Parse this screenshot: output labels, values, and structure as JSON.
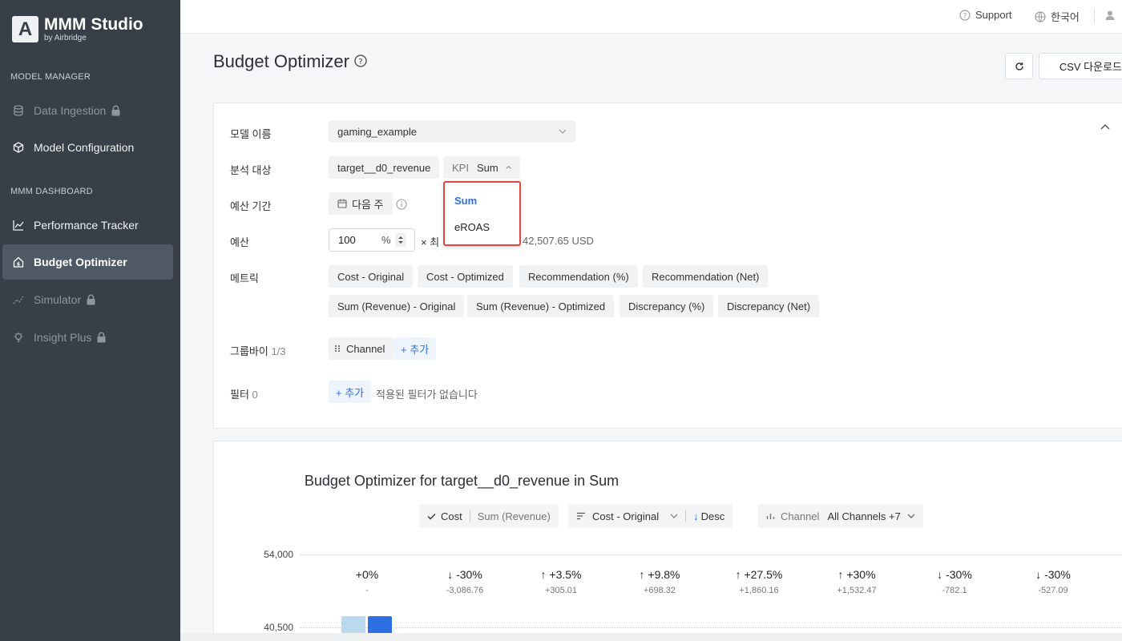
{
  "sidebar": {
    "logo_letter": "A",
    "brand_title": "MMM Studio",
    "brand_sub": "by Airbridge",
    "section_model": "MODEL MANAGER",
    "section_dashboard": "MMM DASHBOARD",
    "items": [
      {
        "label": "Data Ingestion",
        "icon": "database-icon",
        "locked": true
      },
      {
        "label": "Model Configuration",
        "icon": "cube-icon",
        "locked": false
      },
      {
        "label": "Performance Tracker",
        "icon": "line-chart-icon",
        "locked": false
      },
      {
        "label": "Budget Optimizer",
        "icon": "home-dollar-icon",
        "locked": false,
        "active": true
      },
      {
        "label": "Simulator",
        "icon": "trend-icon",
        "locked": true
      },
      {
        "label": "Insight Plus",
        "icon": "bulb-icon",
        "locked": true
      }
    ]
  },
  "topbar": {
    "support": "Support",
    "language": "한국어"
  },
  "page": {
    "title": "Budget Optimizer",
    "csv_button": "CSV 다운로드"
  },
  "form": {
    "model_label": "모델 이름",
    "model_value": "gaming_example",
    "target_label": "분석 대상",
    "target_value": "target__d0_revenue",
    "kpi_prefix": "KPI",
    "kpi_value": "Sum",
    "period_label": "예산 기간",
    "period_value": "다음 주",
    "budget_label": "예산",
    "budget_value": "100",
    "budget_unit": "%",
    "budget_multiplier": "× 최",
    "budget_total": "42,507.65 USD",
    "metric_label": "메트릭",
    "metrics": [
      "Cost - Original",
      "Cost - Optimized",
      "Recommendation (%)",
      "Recommendation (Net)",
      "Sum (Revenue) - Original",
      "Sum (Revenue) - Optimized",
      "Discrepancy (%)",
      "Discrepancy (Net)"
    ],
    "groupby_label": "그룹바이",
    "groupby_count": "1/3",
    "groupby_value": "Channel",
    "add_label": "+ 추가",
    "filter_label": "필터",
    "filter_count": "0",
    "filter_empty": "적용된 필터가 없습니다"
  },
  "kpi_dropdown": {
    "options": [
      "Sum",
      "eROAS"
    ],
    "selected": "Sum"
  },
  "chart_controls": {
    "cost": "Cost",
    "sum_revenue": "Sum (Revenue)",
    "sort_field": "Cost - Original",
    "sort_dir": "Desc",
    "channel_prefix": "Channel",
    "channel_value": "All Channels +7"
  },
  "chart_data": {
    "type": "bar",
    "title": "Budget Optimizer for target__d0_revenue in Sum",
    "y_ticks": [
      "54,000",
      "40,500"
    ],
    "changes": [
      {
        "dir": "none",
        "pct": "+0%",
        "net": "-"
      },
      {
        "dir": "down",
        "pct": "-30%",
        "net": "-3,086.76"
      },
      {
        "dir": "up",
        "pct": "+3.5%",
        "net": "+305.01"
      },
      {
        "dir": "up",
        "pct": "+9.8%",
        "net": "+698.32"
      },
      {
        "dir": "up",
        "pct": "+27.5%",
        "net": "+1,860.16"
      },
      {
        "dir": "up",
        "pct": "+30%",
        "net": "+1,532.47"
      },
      {
        "dir": "down",
        "pct": "-30%",
        "net": "-782.1"
      },
      {
        "dir": "down",
        "pct": "-30%",
        "net": "-527.09"
      }
    ],
    "colors": {
      "original": "#bcd8ec",
      "optimized": "#2f6fe4"
    }
  }
}
